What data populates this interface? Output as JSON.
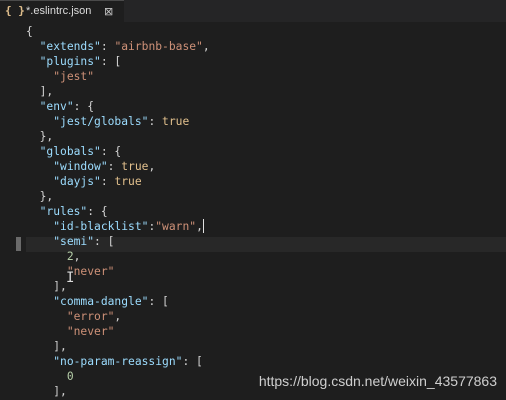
{
  "tab": {
    "icon": "{ }",
    "icon_name": "json-braces-icon",
    "title": "*.eslintrc.json",
    "close": "⊠"
  },
  "code": {
    "l01": "{",
    "l02_key": "\"extends\"",
    "l02_sep": ": ",
    "l02_val": "\"airbnb-base\"",
    "l02_end": ",",
    "l03_key": "\"plugins\"",
    "l03_end": ": [",
    "l04_val": "\"jest\"",
    "l05": "],",
    "l06_key": "\"env\"",
    "l06_end": ": {",
    "l07_key": "\"jest/globals\"",
    "l07_sep": ": ",
    "l07_val": "true",
    "l08": "},",
    "l09_key": "\"globals\"",
    "l09_end": ": {",
    "l10_key": "\"window\"",
    "l10_sep": ": ",
    "l10_val": "true",
    "l10_end": ",",
    "l11_key": "\"dayjs\"",
    "l11_sep": ": ",
    "l11_val": "true",
    "l12": "},",
    "l13_key": "\"rules\"",
    "l13_end": ": {",
    "l14_key": "\"id-blacklist\"",
    "l14_sep": ":",
    "l14_val": "\"warn\"",
    "l14_end": ",",
    "l15_key": "\"semi\"",
    "l15_end": ": [",
    "l16_val": "2",
    "l16_end": ",",
    "l17_val": "\"never\"",
    "l18": "],",
    "l19_key": "\"comma-dangle\"",
    "l19_end": ": [",
    "l20_val": "\"error\"",
    "l20_end": ",",
    "l21_val": "\"never\"",
    "l22": "],",
    "l23_key": "\"no-param-reassign\"",
    "l23_end": ": [",
    "l24_val": "0",
    "l25": "],"
  },
  "colors": {
    "key": "#9cdcfe",
    "string": "#ce9178",
    "boolean": "#e2c08d",
    "number": "#b5cea8",
    "background": "#1e1e1e"
  },
  "watermark": "https://blog.csdn.net/weixin_43577863"
}
